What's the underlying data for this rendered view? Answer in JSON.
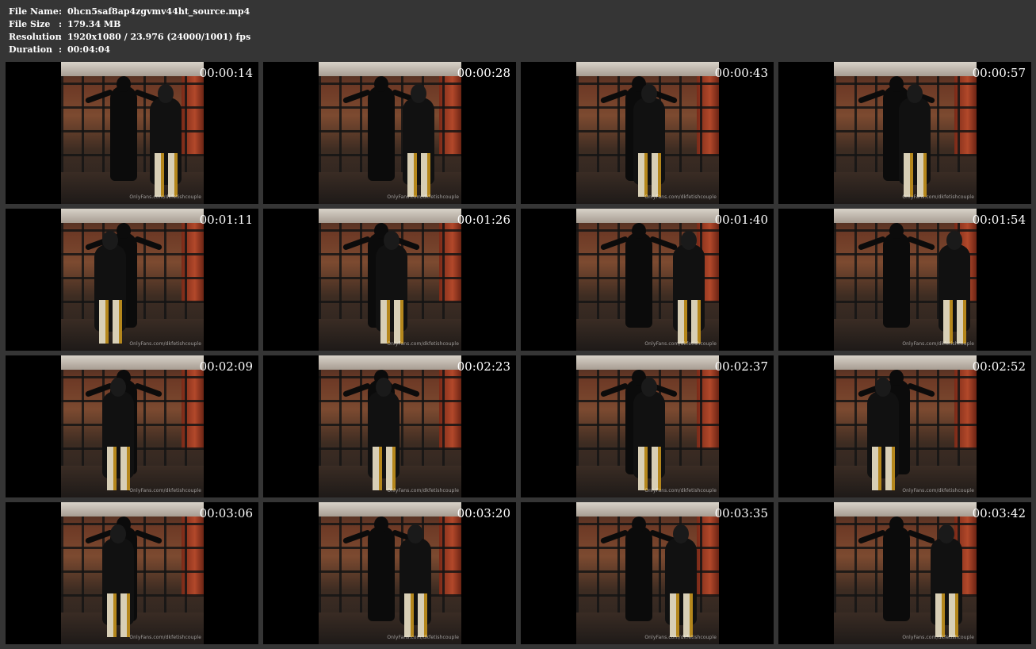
{
  "file_info": {
    "rows": [
      {
        "label": "File Name",
        "sep": ":",
        "value": "0hcn5saf8ap4zgvmv44ht_source.mp4"
      },
      {
        "label": "File Size",
        "sep": ":",
        "value": "179.34 MB"
      },
      {
        "label": "Resolution",
        "sep": ":",
        "value": "1920x1080 / 23.976 (24000/1001) fps"
      },
      {
        "label": "Duration",
        "sep": ":",
        "value": "00:04:04"
      }
    ]
  },
  "watermark_text": "OnlyFans.com/dkfetishcouple",
  "thumbnails": [
    {
      "time": "00:00:14"
    },
    {
      "time": "00:00:28"
    },
    {
      "time": "00:00:43"
    },
    {
      "time": "00:00:57"
    },
    {
      "time": "00:01:11"
    },
    {
      "time": "00:01:26"
    },
    {
      "time": "00:01:40"
    },
    {
      "time": "00:01:54"
    },
    {
      "time": "00:02:09"
    },
    {
      "time": "00:02:23"
    },
    {
      "time": "00:02:37"
    },
    {
      "time": "00:02:52"
    },
    {
      "time": "00:03:06"
    },
    {
      "time": "00:03:20"
    },
    {
      "time": "00:03:35"
    },
    {
      "time": "00:03:42"
    }
  ]
}
